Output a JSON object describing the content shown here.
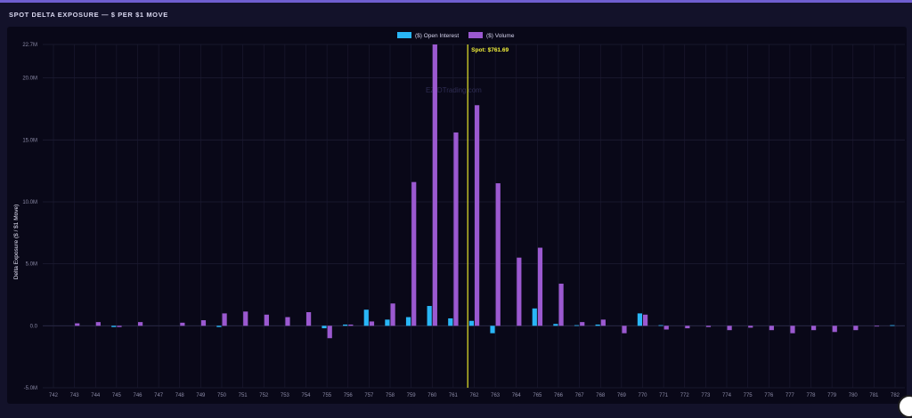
{
  "header": {
    "title": "SPOT DELTA EXPOSURE — $ PER $1 MOVE"
  },
  "colors": {
    "oi": "#29b6f6",
    "volume": "#9b59d0",
    "spot": "#e8e82a",
    "grid": "#1d1c33"
  },
  "chart_data": {
    "type": "bar",
    "watermark": "EZ-DTrading.com",
    "ylabel": "Delta Exposure ($ / $1 Move)",
    "xlabel": "",
    "ylim": [
      -5.0,
      22.7
    ],
    "yticks": [
      {
        "v": 22.7,
        "label": "22.7M"
      },
      {
        "v": 20.0,
        "label": "20.0M"
      },
      {
        "v": 15.0,
        "label": "15.0M"
      },
      {
        "v": 10.0,
        "label": "10.0M"
      },
      {
        "v": 5.0,
        "label": "5.0M"
      },
      {
        "v": 0.0,
        "label": "0.0"
      },
      {
        "v": -5.0,
        "label": "-5.0M"
      }
    ],
    "legend": "top-center",
    "categories": [
      "742",
      "743",
      "744",
      "745",
      "746",
      "747",
      "748",
      "749",
      "750",
      "751",
      "752",
      "753",
      "754",
      "755",
      "756",
      "757",
      "758",
      "759",
      "760",
      "761",
      "762",
      "763",
      "764",
      "765",
      "766",
      "767",
      "768",
      "769",
      "770",
      "771",
      "772",
      "773",
      "774",
      "775",
      "776",
      "777",
      "778",
      "779",
      "780",
      "781",
      "782"
    ],
    "series": [
      {
        "name": "($) Open Interest",
        "color": "#29b6f6",
        "values": [
          0,
          0,
          0,
          -0.1,
          0,
          0,
          0,
          0,
          -0.1,
          0,
          0,
          0,
          0,
          -0.2,
          0.1,
          1.3,
          0.5,
          0.7,
          1.6,
          0.6,
          0.4,
          -0.6,
          0,
          1.4,
          0.15,
          0.05,
          0.1,
          0,
          1.0,
          0.05,
          0,
          0,
          0,
          0,
          0,
          0,
          0,
          0,
          0,
          0,
          0.05
        ]
      },
      {
        "name": "($) Volume",
        "color": "#9b59d0",
        "values": [
          0,
          0.2,
          0.3,
          -0.1,
          0.3,
          0,
          0.25,
          0.45,
          1.0,
          1.15,
          0.9,
          0.7,
          1.1,
          -1.0,
          0.1,
          0.35,
          1.8,
          11.6,
          22.7,
          15.6,
          17.8,
          11.5,
          5.5,
          6.3,
          3.4,
          0.3,
          0.5,
          -0.6,
          0.9,
          -0.3,
          -0.2,
          -0.1,
          -0.35,
          -0.15,
          -0.35,
          -0.6,
          -0.35,
          -0.5,
          -0.35,
          -0.05,
          0
        ]
      }
    ],
    "spot": {
      "label": "Spot: $761.69",
      "value": 761.69
    }
  }
}
